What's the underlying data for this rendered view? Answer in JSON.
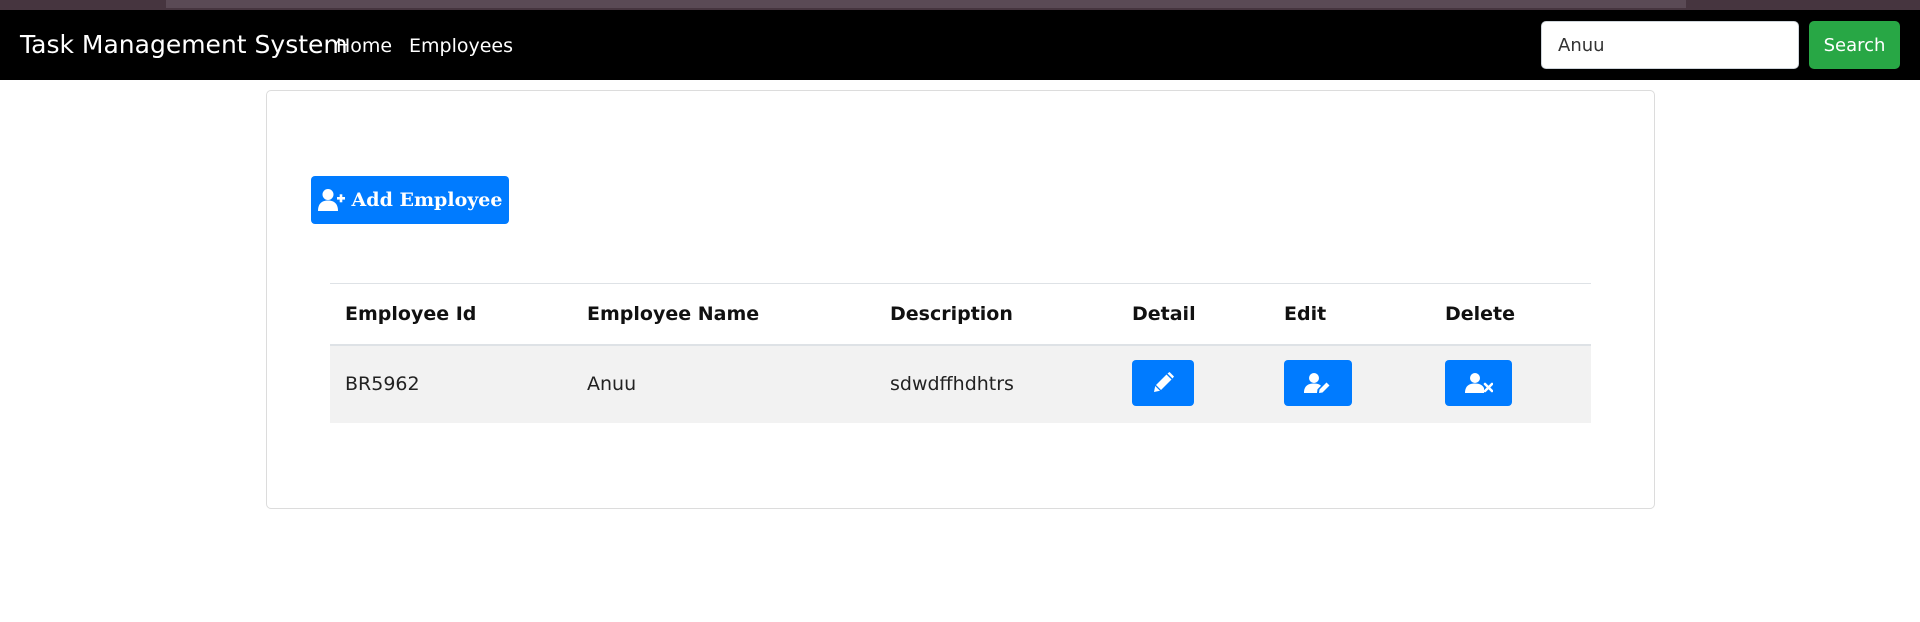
{
  "navbar": {
    "brand": "Task Management System",
    "links": [
      "Home",
      "Employees"
    ],
    "search": {
      "value": "Anuu",
      "button_label": "Search"
    }
  },
  "main": {
    "add_button_label": "Add Employee",
    "add_button_icon": "user-plus-icon",
    "table": {
      "headers": [
        "Employee Id",
        "Employee Name",
        "Description",
        "Detail",
        "Edit",
        "Delete"
      ],
      "rows": [
        {
          "employee_id": "BR5962",
          "employee_name": "Anuu",
          "description": "sdwdffhdhtrs",
          "detail_icon": "pen-icon",
          "edit_icon": "user-edit-icon",
          "delete_icon": "user-delete-icon"
        }
      ]
    }
  },
  "colors": {
    "navbar_bg": "#000000",
    "primary": "#007bff",
    "success": "#28a745",
    "row_bg": "#f2f2f2"
  }
}
